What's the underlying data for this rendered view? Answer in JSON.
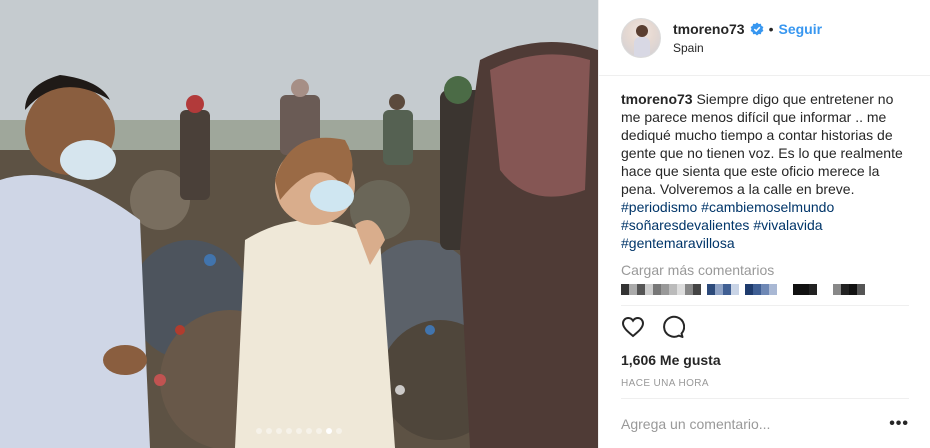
{
  "post": {
    "author": {
      "username": "tmoreno73",
      "verified": true,
      "follow_label": "Seguir",
      "location": "Spain"
    },
    "caption": {
      "username": "tmoreno73",
      "text": "Siempre digo que entretener no me parece menos difícil que informar .. me dediqué mucho tiempo a contar historias de gente que no tienen voz. Es lo que realmente hace que sienta que este oficio merece la pena. Volveremos a la calle en breve.",
      "hashtags": [
        "#periodismo",
        "#cambiemoselmundo",
        "#soñaresdevalientes",
        "#vivalavida",
        "#gentemaravillosa"
      ]
    },
    "load_more_label": "Cargar más comentarios",
    "likes_label": "1,606 Me gusta",
    "time_label": "HACE UNA HORA",
    "comment_placeholder": "Agrega un comentario...",
    "more_label": "•••",
    "carousel": {
      "count": 9,
      "active_index": 7
    }
  },
  "icons": {
    "verified": "verified-badge-icon",
    "like": "heart-icon",
    "comment": "comment-bubble-icon",
    "options": "more-options-icon"
  },
  "colors": {
    "link": "#3897f0",
    "hashtag": "#003569",
    "muted": "#999999",
    "border": "#efefef",
    "text": "#262626"
  }
}
